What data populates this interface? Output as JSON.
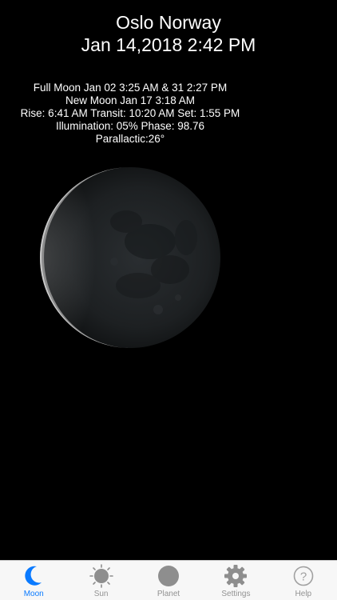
{
  "header": {
    "location": "Oslo Norway",
    "datetime": "Jan 14,2018 2:42 PM"
  },
  "info": {
    "full_moon": "Full Moon Jan 02 3:25 AM & 31 2:27 PM",
    "new_moon": "New Moon Jan 17 3:18 AM",
    "rise_transit_set": "Rise: 6:41 AM Transit: 10:20 AM Set: 1:55 PM",
    "illumination_phase": "Illumination: 05% Phase: 98.76",
    "parallactic": "Parallactic:26°"
  },
  "moon": {
    "illumination_fraction": 0.05,
    "lit_limb": "left"
  },
  "tabbar": {
    "active_color": "#0a7aff",
    "inactive_color": "#929292",
    "tabs": [
      {
        "label": "Moon",
        "icon": "crescent-moon-icon",
        "active": true
      },
      {
        "label": "Sun",
        "icon": "sun-icon",
        "active": false
      },
      {
        "label": "Planet",
        "icon": "planet-icon",
        "active": false
      },
      {
        "label": "Settings",
        "icon": "gear-icon",
        "active": false
      },
      {
        "label": "Help",
        "icon": "help-icon",
        "active": false
      }
    ]
  }
}
